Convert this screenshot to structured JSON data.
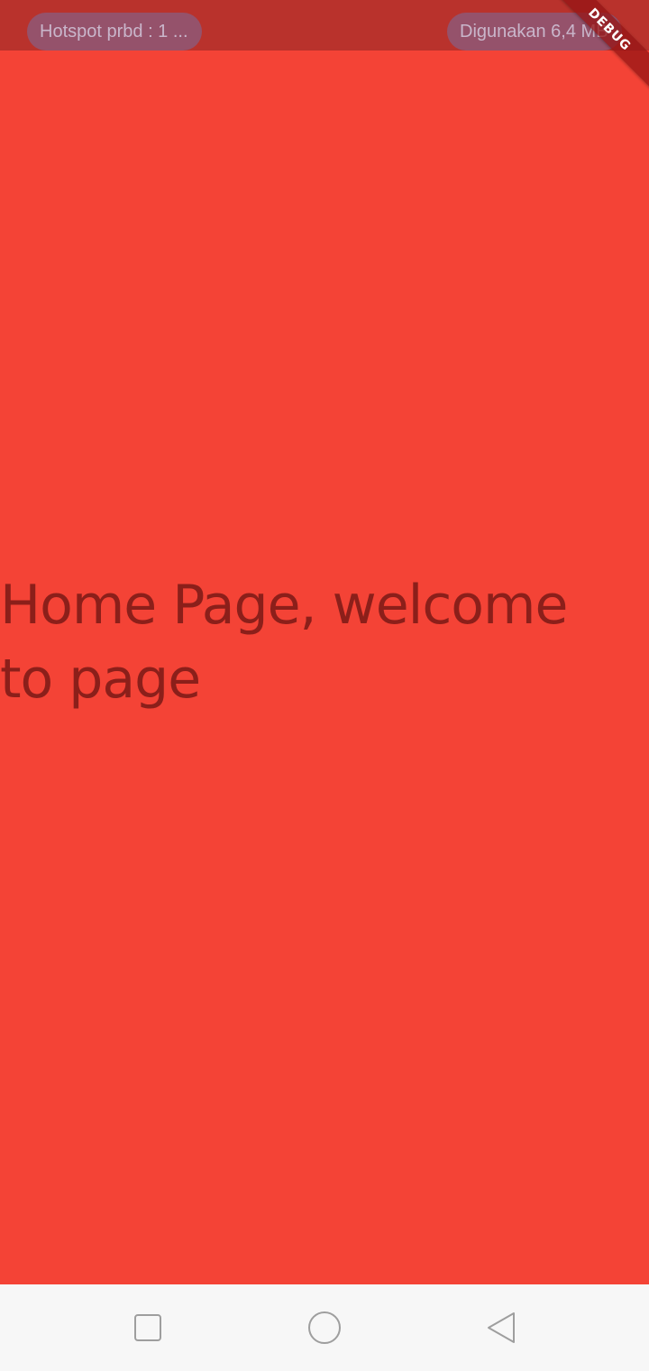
{
  "status_bar": {
    "left_pill": "Hotspot prbd : 1 ...",
    "right_pill": "Digunakan 6,4 MB",
    "bg_color": "#b9322c"
  },
  "debug_banner": {
    "label": "DEBUG"
  },
  "main": {
    "text": "Home Page, welcome to page",
    "bg_color": "#f44336",
    "text_color": "#8b1f1a"
  },
  "nav_bar": {
    "buttons": [
      {
        "icon": "square-recent-apps-icon"
      },
      {
        "icon": "circle-home-icon"
      },
      {
        "icon": "triangle-back-icon"
      }
    ]
  }
}
